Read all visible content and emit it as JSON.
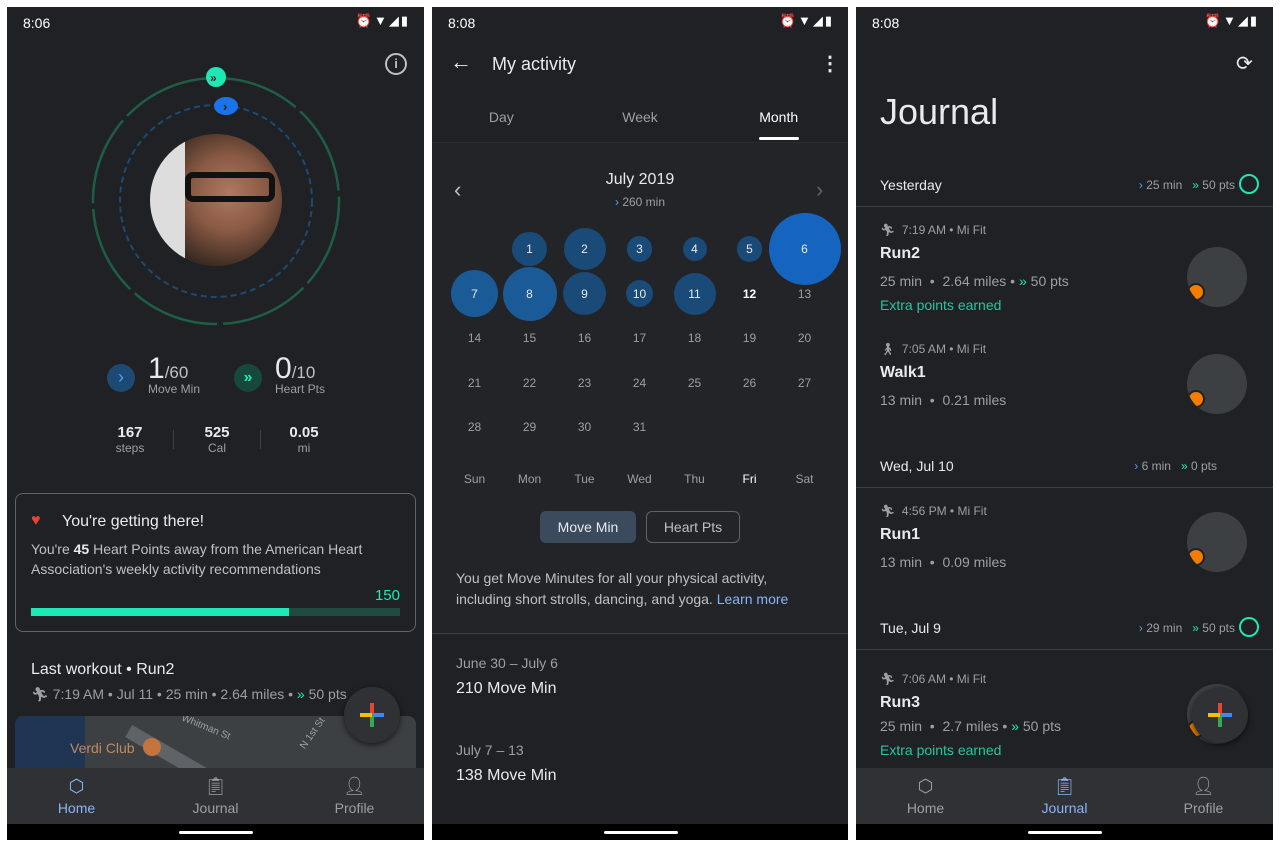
{
  "home": {
    "status_time": "8:06",
    "move_min": {
      "value": "1",
      "goal": "/60",
      "label": "Move Min",
      "progress": 0.02
    },
    "heart_pts": {
      "value": "0",
      "goal": "/10",
      "label": "Heart Pts",
      "progress": 0.0
    },
    "stats": [
      {
        "value": "167",
        "label": "steps"
      },
      {
        "value": "525",
        "label": "Cal"
      },
      {
        "value": "0.05",
        "label": "mi"
      }
    ],
    "card": {
      "title": "You're getting there!",
      "text_pre": "You're ",
      "text_bold": "45",
      "text_post": " Heart Points away from the American Heart Association's weekly activity recommendations",
      "goal": "150",
      "progress": 0.7
    },
    "last_workout": {
      "title": "Last workout • Run2",
      "details": "7:19 AM • Jul 11 • 25 min • 2.64 miles • ",
      "pts": "50 pts"
    },
    "map": {
      "place": "Verdi Club",
      "streets": [
        "Whitman St",
        "N 1st St"
      ]
    }
  },
  "nav": {
    "home": "Home",
    "journal": "Journal",
    "profile": "Profile"
  },
  "activity": {
    "status_time": "8:08",
    "title": "My activity",
    "tabs": [
      "Day",
      "Week",
      "Month"
    ],
    "active_tab": "Month",
    "month": "July 2019",
    "month_total": "260 min",
    "days": [
      {
        "d": "1",
        "col": 1,
        "row": 0,
        "level": 0.38
      },
      {
        "d": "2",
        "col": 2,
        "row": 0,
        "level": 0.5
      },
      {
        "d": "3",
        "col": 3,
        "row": 0,
        "level": 0.22
      },
      {
        "d": "4",
        "col": 4,
        "row": 0,
        "level": 0.2
      },
      {
        "d": "5",
        "col": 5,
        "row": 0,
        "level": 0.22
      },
      {
        "d": "6",
        "col": 6,
        "row": 0,
        "level": 1.0
      },
      {
        "d": "7",
        "col": 0,
        "row": 1,
        "level": 0.58
      },
      {
        "d": "8",
        "col": 1,
        "row": 1,
        "level": 0.7
      },
      {
        "d": "9",
        "col": 2,
        "row": 1,
        "level": 0.52
      },
      {
        "d": "10",
        "col": 3,
        "row": 1,
        "level": 0.25
      },
      {
        "d": "11",
        "col": 4,
        "row": 1,
        "level": 0.5
      },
      {
        "d": "12",
        "col": 5,
        "row": 1,
        "level": 0,
        "today": true
      },
      {
        "d": "13",
        "col": 6,
        "row": 1,
        "level": 0
      },
      {
        "d": "14",
        "col": 0,
        "row": 2
      },
      {
        "d": "15",
        "col": 1,
        "row": 2
      },
      {
        "d": "16",
        "col": 2,
        "row": 2
      },
      {
        "d": "17",
        "col": 3,
        "row": 2
      },
      {
        "d": "18",
        "col": 4,
        "row": 2
      },
      {
        "d": "19",
        "col": 5,
        "row": 2
      },
      {
        "d": "20",
        "col": 6,
        "row": 2
      },
      {
        "d": "21",
        "col": 0,
        "row": 3
      },
      {
        "d": "22",
        "col": 1,
        "row": 3
      },
      {
        "d": "23",
        "col": 2,
        "row": 3
      },
      {
        "d": "24",
        "col": 3,
        "row": 3
      },
      {
        "d": "25",
        "col": 4,
        "row": 3
      },
      {
        "d": "26",
        "col": 5,
        "row": 3
      },
      {
        "d": "27",
        "col": 6,
        "row": 3
      },
      {
        "d": "28",
        "col": 0,
        "row": 4
      },
      {
        "d": "29",
        "col": 1,
        "row": 4
      },
      {
        "d": "30",
        "col": 2,
        "row": 4
      },
      {
        "d": "31",
        "col": 3,
        "row": 4
      }
    ],
    "weekdays": [
      "Sun",
      "Mon",
      "Tue",
      "Wed",
      "Thu",
      "Fri",
      "Sat"
    ],
    "toggle": [
      "Move Min",
      "Heart Pts"
    ],
    "info_text": "You get Move Minutes for all your physical activity, including short strolls, dancing, and yoga. ",
    "learn_more": "Learn more",
    "weeks": [
      {
        "range": "June 30 – July 6",
        "total": "210 Move Min"
      },
      {
        "range": "July 7 – 13",
        "total": "138 Move Min"
      }
    ]
  },
  "journal": {
    "status_time": "8:08",
    "title": "Journal",
    "groups": [
      {
        "date": "Yesterday",
        "min": "25 min",
        "pts": "50 pts"
      },
      {
        "date": "Wed, Jul 10",
        "min": "6 min",
        "pts": "0 pts"
      },
      {
        "date": "Tue, Jul 9",
        "min": "29 min",
        "pts": "50 pts"
      }
    ],
    "entries": [
      {
        "meta": "7:19 AM • Mi Fit",
        "name": "Run2",
        "stats": "25 min  •  2.64 miles • ",
        "pts": "50 pts",
        "extra": "Extra points earned"
      },
      {
        "meta": "7:05 AM • Mi Fit",
        "name": "Walk1",
        "stats": "13 min  •  0.21 miles"
      },
      {
        "meta": "4:56 PM • Mi Fit",
        "name": "Run1",
        "stats": "13 min  •  0.09 miles"
      },
      {
        "meta": "7:06 AM • Mi Fit",
        "name": "Run3",
        "stats": "25 min  •  2.7 miles • ",
        "pts": "50 pts",
        "extra": "Extra points earned"
      }
    ]
  },
  "colors": {
    "bg": "#202124",
    "move": "#4da3ff",
    "heart": "#1de9b6",
    "nav_active": "#8ab4f8"
  }
}
